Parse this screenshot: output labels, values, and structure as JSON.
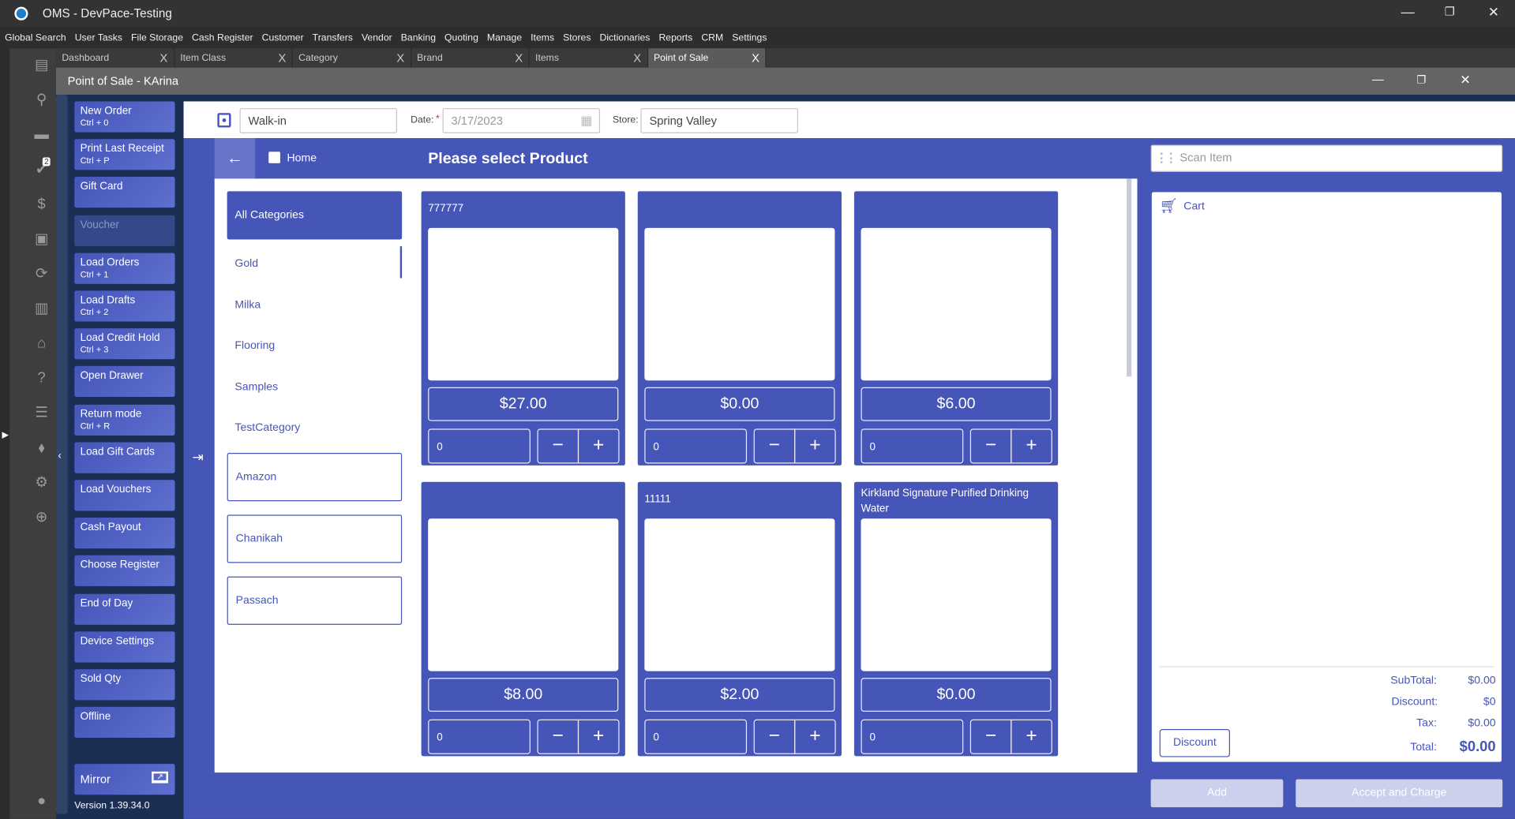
{
  "app_title": "OMS - DevPace-Testing",
  "menu": [
    "Global Search",
    "User Tasks",
    "File Storage",
    "Cash Register",
    "Customer",
    "Transfers",
    "Vendor",
    "Banking",
    "Quoting",
    "Manage",
    "Items",
    "Stores",
    "Dictionaries",
    "Reports",
    "CRM",
    "Settings"
  ],
  "tabs": [
    {
      "label": "Dashboard"
    },
    {
      "label": "Item Class"
    },
    {
      "label": "Category"
    },
    {
      "label": "Brand"
    },
    {
      "label": "Items"
    },
    {
      "label": "Point of Sale",
      "active": true
    }
  ],
  "tab_close": "X",
  "window_title": "Point of Sale - KArina",
  "rail_badge": "2",
  "actions": [
    {
      "label": "New Order",
      "shortcut": "Ctrl + 0"
    },
    {
      "label": "Print Last Receipt",
      "shortcut": "Ctrl + P"
    },
    {
      "label": "Gift Card"
    },
    {
      "label": "Voucher",
      "disabled": true
    },
    {
      "label": "Load Orders",
      "shortcut": "Ctrl + 1"
    },
    {
      "label": "Load Drafts",
      "shortcut": "Ctrl + 2"
    },
    {
      "label": "Load Credit Hold",
      "shortcut": "Ctrl + 3"
    },
    {
      "label": "Open Drawer"
    },
    {
      "label": "Return mode",
      "shortcut": "Ctrl + R"
    },
    {
      "label": "Load Gift Cards"
    },
    {
      "label": "Load Vouchers"
    },
    {
      "label": "Cash Payout"
    },
    {
      "label": "Choose Register"
    },
    {
      "label": "End of Day"
    },
    {
      "label": "Device Settings"
    },
    {
      "label": "Sold Qty"
    },
    {
      "label": "Offline"
    }
  ],
  "mirror_label": "Mirror",
  "version": "Version 1.39.34.0",
  "header": {
    "customer": "Walk-in",
    "date_label": "Date:",
    "required": "*",
    "date": "3/17/2023",
    "store_label": "Store:",
    "store": "Spring Valley"
  },
  "nav": {
    "home": "Home",
    "title": "Please select Product",
    "scan_placeholder": "Scan Item"
  },
  "categories": [
    {
      "label": "All Categories",
      "style": "active"
    },
    {
      "label": "Gold",
      "style": "plain"
    },
    {
      "label": "Milka",
      "style": "plain"
    },
    {
      "label": "Flooring",
      "style": "plain"
    },
    {
      "label": "Samples",
      "style": "plain"
    },
    {
      "label": "TestCategory",
      "style": "plain"
    },
    {
      "label": "Amazon",
      "style": "box"
    },
    {
      "label": "Chanikah",
      "style": "box"
    },
    {
      "label": "Passach",
      "style": "box"
    }
  ],
  "products": [
    {
      "name": "777777",
      "price": "$27.00",
      "qty": "0"
    },
    {
      "name": "",
      "price": "$0.00",
      "qty": "0"
    },
    {
      "name": "",
      "price": "$6.00",
      "qty": "0"
    },
    {
      "name": "",
      "price": "$8.00",
      "qty": "0"
    },
    {
      "name": "11111",
      "price": "$2.00",
      "qty": "0"
    },
    {
      "name": "Kirkland Signature Purified Drinking Water",
      "price": "$0.00",
      "qty": "0"
    }
  ],
  "minus": "−",
  "plus": "+",
  "cart": {
    "title": "Cart",
    "subtotal_label": "SubTotal:",
    "subtotal": "$0.00",
    "discount_label": "Discount:",
    "discount": "$0",
    "tax_label": "Tax:",
    "tax": "$0.00",
    "total_label": "Total:",
    "total": "$0.00",
    "discount_button": "Discount"
  },
  "add_label": "Add",
  "accept_label": "Accept and Charge",
  "colors": {
    "accent": "#4656b8",
    "navy": "#1b2f55"
  }
}
